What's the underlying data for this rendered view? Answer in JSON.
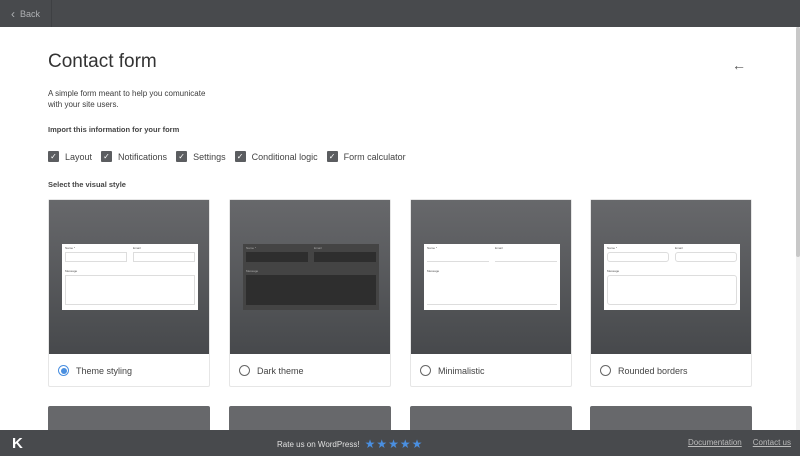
{
  "topbar": {
    "back_label": "Back"
  },
  "page": {
    "title": "Contact form",
    "description": "A simple form meant to help you comunicate with your site users.",
    "import_label": "Import this information for your form",
    "style_label": "Select the visual style"
  },
  "checkboxes": [
    {
      "label": "Layout",
      "checked": true
    },
    {
      "label": "Notifications",
      "checked": true
    },
    {
      "label": "Settings",
      "checked": true
    },
    {
      "label": "Conditional logic",
      "checked": true
    },
    {
      "label": "Form calculator",
      "checked": true
    }
  ],
  "preview_fields": {
    "name": "Name *",
    "email": "Email",
    "message": "Message"
  },
  "styles": [
    {
      "label": "Theme styling",
      "selected": true
    },
    {
      "label": "Dark theme",
      "selected": false
    },
    {
      "label": "Minimalistic",
      "selected": false
    },
    {
      "label": "Rounded borders",
      "selected": false
    }
  ],
  "footer": {
    "logo": "K",
    "rate_text": "Rate us on WordPress!",
    "stars": "★★★★★",
    "links": [
      "Documentation",
      "Contact us"
    ]
  },
  "colors": {
    "accent": "#4a8fe0",
    "bar": "#484a4d"
  }
}
